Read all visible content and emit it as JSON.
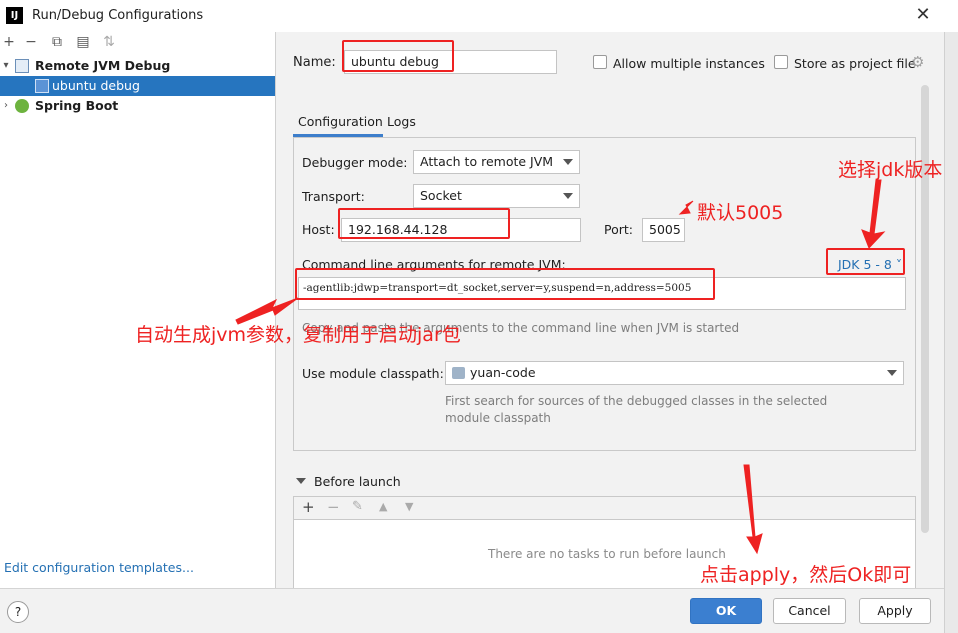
{
  "window": {
    "title": "Run/Debug Configurations",
    "app_icon": "IJ"
  },
  "tree": {
    "groups": [
      {
        "label": "Remote JVM Debug",
        "expanded": true,
        "children": [
          {
            "label": "ubuntu debug",
            "selected": true
          }
        ]
      },
      {
        "label": "Spring Boot",
        "expanded": false,
        "children": []
      }
    ],
    "edit_templates": "Edit configuration templates..."
  },
  "form": {
    "name_label": "Name:",
    "name_value": "ubuntu debug",
    "allow_multiple": {
      "label": "Allow multiple instances",
      "checked": false
    },
    "store_as_project": {
      "label": "Store as project file",
      "checked": false
    },
    "tabs": [
      {
        "label": "Configuration",
        "active": true
      },
      {
        "label": "Logs",
        "active": false
      }
    ],
    "debugger_mode_label": "Debugger mode:",
    "debugger_mode_value": "Attach to remote JVM",
    "transport_label": "Transport:",
    "transport_value": "Socket",
    "host_label": "Host:",
    "host_value": "192.168.44.128",
    "port_label": "Port:",
    "port_value": "5005",
    "args_label": "Command line arguments for remote JVM:",
    "jdk_link": "JDK 5 - 8",
    "args_value": "-agentlib:jdwp=transport=dt_socket,server=y,suspend=n,address=5005",
    "args_hint": "Copy and paste the arguments to the command line when JVM is started",
    "module_label": "Use module classpath:",
    "module_value": "yuan-code",
    "module_hint": "First search for sources of the debugged classes in the selected module classpath",
    "before_launch_label": "Before launch",
    "no_tasks": "There are no tasks to run before launch"
  },
  "buttons": {
    "help": "?",
    "ok": "OK",
    "cancel": "Cancel",
    "apply": "Apply"
  },
  "annotations": {
    "jdk_note": "选择jdk版本",
    "port_note": "默认5005",
    "args_note": "自动生成jvm参数，复制用于启动jar包",
    "apply_note": "点击apply，然后Ok即可",
    "color": "#e82020"
  },
  "colors": {
    "selection": "#2675bf",
    "link": "#2470b3",
    "primary_button": "#3b7fd0"
  }
}
